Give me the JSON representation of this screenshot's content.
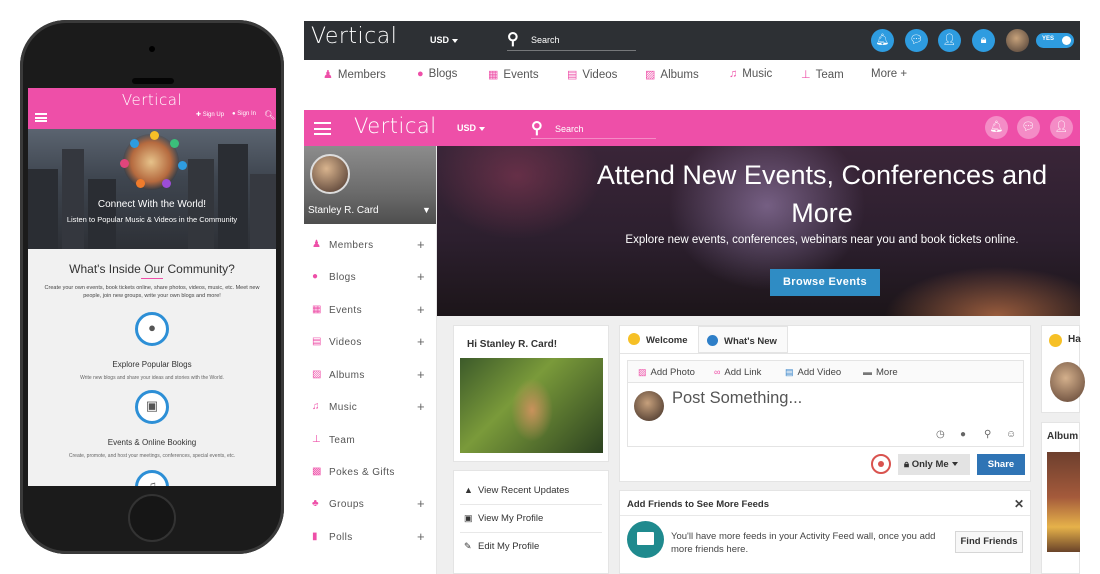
{
  "mobile": {
    "logo": "Vertical",
    "signup": "Sign Up",
    "signin": "Sign In",
    "hero_title": "Connect With the World!",
    "hero_sub": "Listen to Popular Music & Videos in the Community",
    "inside_title": "What's Inside Our Community?",
    "inside_desc": "Create your own events, book tickets online, share photos, videos, music, etc. Meet new people, join new groups, write your own blogs and more!",
    "features": [
      {
        "title": "Explore Popular Blogs",
        "desc": "Write new blogs and share your ideas and stories with the World."
      },
      {
        "title": "Events & Online Booking",
        "desc": "Create, promote, and host your meetings, conferences, special events, etc."
      }
    ]
  },
  "topbar": {
    "logo": "Vertical",
    "currency": "USD",
    "search_placeholder": "Search",
    "toggle_label": "YES"
  },
  "nav": [
    {
      "label": "Members",
      "icon": "members-icon"
    },
    {
      "label": "Blogs",
      "icon": "blogs-icon"
    },
    {
      "label": "Events",
      "icon": "events-icon"
    },
    {
      "label": "Videos",
      "icon": "videos-icon"
    },
    {
      "label": "Albums",
      "icon": "albums-icon"
    },
    {
      "label": "Music",
      "icon": "music-icon"
    },
    {
      "label": "Team",
      "icon": "team-icon"
    },
    {
      "label": "More +",
      "icon": ""
    }
  ],
  "pinkbar": {
    "logo": "Vertical",
    "currency": "USD",
    "search_placeholder": "Search"
  },
  "sidebar": {
    "user_name": "Stanley R. Card",
    "items": [
      {
        "label": "Members",
        "plus": "+"
      },
      {
        "label": "Blogs",
        "plus": "+"
      },
      {
        "label": "Events",
        "plus": "+"
      },
      {
        "label": "Videos",
        "plus": "+"
      },
      {
        "label": "Albums",
        "plus": "+"
      },
      {
        "label": "Music",
        "plus": "+"
      },
      {
        "label": "Team",
        "plus": ""
      },
      {
        "label": "Pokes & Gifts",
        "plus": ""
      },
      {
        "label": "Groups",
        "plus": "+"
      },
      {
        "label": "Polls",
        "plus": "+"
      }
    ]
  },
  "hero": {
    "title": "Attend New Events, Conferences and More",
    "subtitle": "Explore new events, conferences, webinars near you and book tickets online.",
    "button": "Browse Events"
  },
  "hi_card": {
    "greeting": "Hi Stanley R. Card!",
    "menu": [
      "View Recent Updates",
      "View My Profile",
      "Edit My Profile"
    ]
  },
  "composer": {
    "tab_welcome": "Welcome",
    "tab_whats_new": "What's New",
    "tools": [
      "Add Photo",
      "Add Link",
      "Add Video",
      "More"
    ],
    "placeholder": "Post Something...",
    "privacy": "Only Me",
    "share": "Share"
  },
  "add_friends": {
    "title": "Add Friends to See More Feeds",
    "close": "✕",
    "text": "You'll have more feeds in your Activity Feed wall, once you add more friends here.",
    "button": "Find Friends"
  },
  "right_col": {
    "partial_title": "Ha",
    "album_title": "Album"
  },
  "colors": {
    "brand_pink": "#ee4fa8",
    "dark_bar": "#2d3034",
    "accent_blue": "#2e9ce0"
  }
}
